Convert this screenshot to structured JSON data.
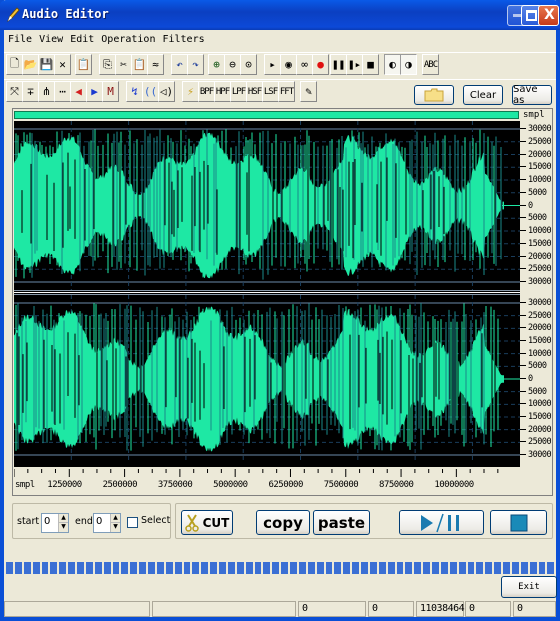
{
  "window": {
    "title": "Audio Editor",
    "controls": {
      "minimize": "_",
      "maximize": "□",
      "close": "X"
    }
  },
  "menu": [
    "File",
    "View",
    "Edit",
    "Operation",
    "Filters"
  ],
  "toolbar1": [
    {
      "name": "new-file",
      "icon": "new-file-icon",
      "glyph": "🗋"
    },
    {
      "name": "open-file",
      "icon": "open-folder-icon",
      "glyph": "📂"
    },
    {
      "name": "save-file",
      "icon": "save-icon",
      "glyph": "💾"
    },
    {
      "name": "close-file",
      "icon": "close-x-icon",
      "glyph": "✕"
    },
    {
      "name": "properties",
      "icon": "properties-icon",
      "glyph": "📋"
    },
    {
      "name": "copy",
      "icon": "copy-icon",
      "glyph": "⎘"
    },
    {
      "name": "cut",
      "icon": "scissors-icon",
      "glyph": "✂"
    },
    {
      "name": "paste",
      "icon": "paste-icon",
      "glyph": "📋"
    },
    {
      "name": "mix-paste",
      "icon": "mix-paste-icon",
      "glyph": "≈"
    },
    {
      "name": "undo",
      "icon": "undo-icon",
      "glyph": "↶"
    },
    {
      "name": "redo",
      "icon": "redo-icon",
      "glyph": "↷"
    },
    {
      "name": "zoom-in",
      "icon": "zoom-in-icon",
      "glyph": "⊕"
    },
    {
      "name": "zoom-out",
      "icon": "zoom-out-icon",
      "glyph": "⊖"
    },
    {
      "name": "zoom-fit",
      "icon": "zoom-fit-icon",
      "glyph": "⊙"
    },
    {
      "name": "play",
      "icon": "play-icon",
      "glyph": "▸"
    },
    {
      "name": "play-selection",
      "icon": "play-circle-icon",
      "glyph": "◉"
    },
    {
      "name": "loop",
      "icon": "loop-icon",
      "glyph": "∞"
    },
    {
      "name": "record",
      "icon": "record-icon",
      "glyph": "●"
    },
    {
      "name": "pause",
      "icon": "pause-icon",
      "glyph": "❚❚"
    },
    {
      "name": "step",
      "icon": "step-icon",
      "glyph": "❚▸"
    },
    {
      "name": "stop",
      "icon": "stop-icon",
      "glyph": "■"
    },
    {
      "name": "stereo-left",
      "icon": "speaker-left-icon",
      "glyph": "◐"
    },
    {
      "name": "stereo-right",
      "icon": "speaker-right-icon",
      "glyph": "◑"
    },
    {
      "name": "abc",
      "icon": "abc-icon",
      "glyph": "ABC"
    }
  ],
  "toolbar2": [
    {
      "name": "select-all",
      "icon": "select-all-icon",
      "glyph": "⤧"
    },
    {
      "name": "trim",
      "icon": "trim-icon",
      "glyph": "∓"
    },
    {
      "name": "normalize",
      "icon": "normalize-icon",
      "glyph": "⋔"
    },
    {
      "name": "silence",
      "icon": "silence-icon",
      "glyph": "⋯"
    },
    {
      "name": "fade-in",
      "icon": "fade-in-icon",
      "glyph": "◀"
    },
    {
      "name": "fade-out",
      "icon": "fade-out-icon",
      "glyph": "▶"
    },
    {
      "name": "amplify",
      "icon": "amplify-icon",
      "glyph": "M"
    },
    {
      "name": "reverse",
      "icon": "reverse-icon",
      "glyph": "↯"
    },
    {
      "name": "echo",
      "icon": "echo-icon",
      "glyph": "(("
    },
    {
      "name": "reverb",
      "icon": "reverb-icon",
      "glyph": "◁)"
    },
    {
      "name": "equalizer",
      "icon": "equalizer-icon",
      "glyph": "⚡"
    },
    {
      "name": "bpf",
      "icon": "bpf-icon",
      "glyph": "BPF"
    },
    {
      "name": "hpf",
      "icon": "hpf-icon",
      "glyph": "HPF"
    },
    {
      "name": "lpf",
      "icon": "lpf-icon",
      "glyph": "LPF"
    },
    {
      "name": "hsf",
      "icon": "hsf-icon",
      "glyph": "HSF"
    },
    {
      "name": "lsf",
      "icon": "lsf-icon",
      "glyph": "LSF"
    },
    {
      "name": "fft",
      "icon": "fft-icon",
      "glyph": "FFT"
    },
    {
      "name": "edit-pencil",
      "icon": "pencil-icon",
      "glyph": "✎"
    }
  ],
  "actions": {
    "open": "",
    "clear": "Clear",
    "save_as": "Save as"
  },
  "waveform": {
    "unit_label": "smpl",
    "y_ticks": [
      "30000",
      "25000",
      "20000",
      "15000",
      "10000",
      "5000",
      "0",
      "5000",
      "10000",
      "15000",
      "20000",
      "25000",
      "30000"
    ],
    "x_ticks": [
      "1250000",
      "2500000",
      "3750000",
      "5000000",
      "6250000",
      "7500000",
      "8750000",
      "10000000"
    ],
    "x_unit": "smpl",
    "total_samples": 11038464,
    "wave_color": "#1ee8a4",
    "grid_color": "#1a3d5c"
  },
  "selection": {
    "start_label": "start",
    "start_value": "0",
    "end_label": "end",
    "end_value": "0",
    "select_label": "Select",
    "select_checked": false
  },
  "edit_buttons": {
    "cut": "CUT",
    "copy": "copy",
    "paste": "paste"
  },
  "playback": {
    "play_pause": "▶/❚❚",
    "stop": "■"
  },
  "progress": {
    "fraction": 1.0
  },
  "exit": "Exit",
  "status": [
    "",
    "",
    "0",
    "0",
    "11038464",
    "0",
    "0"
  ]
}
